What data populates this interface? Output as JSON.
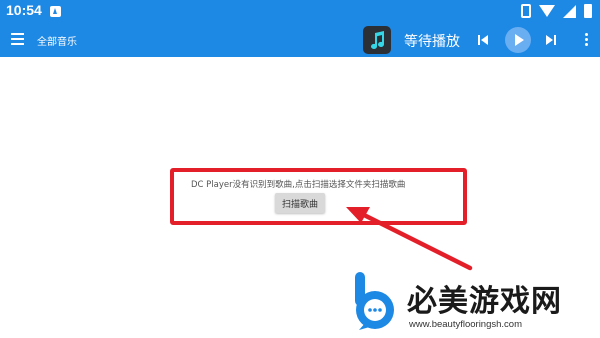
{
  "status_bar": {
    "time": "10:54",
    "icons": [
      "notification-icon",
      "vibrate-icon",
      "wifi-icon",
      "signal-icon",
      "battery-icon"
    ]
  },
  "toolbar": {
    "title": "全部音乐",
    "now_playing": "等待播放",
    "icons": [
      "menu-icon",
      "music-note-icon",
      "skip-previous-icon",
      "play-icon",
      "skip-next-icon",
      "more-vert-icon"
    ]
  },
  "content": {
    "empty_message": "DC Player没有识别到歌曲,点击扫描选择文件夹扫描歌曲",
    "scan_button_label": "扫描歌曲"
  },
  "watermark": {
    "title": "必美游戏网",
    "url": "www.beautyflooringsh.com"
  },
  "colors": {
    "primary": "#1e88e5",
    "play_button": "#6aaef2",
    "annotation_red": "#e3202a",
    "album_art_bg": "#2b2f36",
    "note_cyan": "#35d6e6"
  }
}
